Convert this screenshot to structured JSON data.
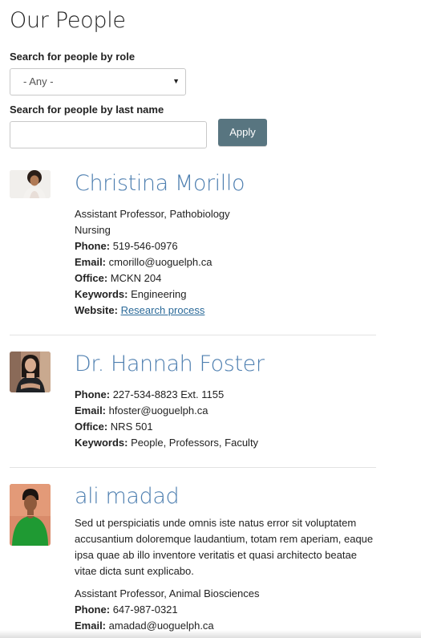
{
  "page": {
    "title": "Our People"
  },
  "filters": {
    "role_label": "Search for people by role",
    "role_selected": "- Any -",
    "lastname_label": "Search for people by last name",
    "lastname_value": "",
    "apply_label": "Apply"
  },
  "people": [
    {
      "name": "Christina Morillo",
      "title_line": "Assistant Professor, Pathobiology",
      "unit_line": "Nursing",
      "phone_label": "Phone:",
      "phone": "519-546-0976",
      "email_label": "Email:",
      "email": "cmorillo@uoguelph.ca",
      "office_label": "Office:",
      "office": "MCKN 204",
      "keywords_label": "Keywords:",
      "keywords": "Engineering",
      "website_label": "Website:",
      "website": "Research process"
    },
    {
      "name": "Dr. Hannah Foster",
      "phone_label": "Phone:",
      "phone": "227-534-8823 Ext. 1155",
      "email_label": "Email:",
      "email": "hfoster@uoguelph.ca",
      "office_label": "Office:",
      "office": "NRS 501",
      "keywords_label": "Keywords:",
      "keywords": "People, Professors, Faculty"
    },
    {
      "name": "ali madad",
      "bio": "Sed ut perspiciatis unde omnis iste natus error sit voluptatem accusantium doloremque laudantium, totam rem aperiam, eaque ipsa quae ab illo inventore veritatis et quasi architecto beatae vitae dicta sunt explicabo.",
      "title_line": "Assistant Professor, Animal Biosciences",
      "phone_label": "Phone:",
      "phone": "647-987-0321",
      "email_label": "Email:",
      "email": "amadad@uoguelph.ca"
    }
  ],
  "colors": {
    "name_link": "#4e7fb0",
    "apply_button": "#587580",
    "website_link": "#2b6a99"
  },
  "icons": {
    "select_caret": "caret-down-icon"
  }
}
